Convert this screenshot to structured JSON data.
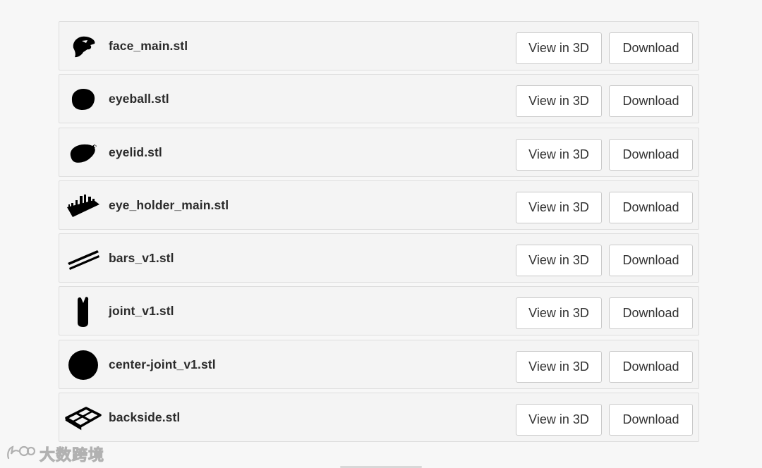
{
  "files": [
    {
      "name": "face_main.stl",
      "icon": "face-main-model-icon",
      "view_label": "View in 3D",
      "download_label": "Download"
    },
    {
      "name": "eyeball.stl",
      "icon": "eyeball-model-icon",
      "view_label": "View in 3D",
      "download_label": "Download"
    },
    {
      "name": "eyelid.stl",
      "icon": "eyelid-model-icon",
      "view_label": "View in 3D",
      "download_label": "Download"
    },
    {
      "name": "eye_holder_main.stl",
      "icon": "eye-holder-model-icon",
      "view_label": "View in 3D",
      "download_label": "Download"
    },
    {
      "name": "bars_v1.stl",
      "icon": "bars-model-icon",
      "view_label": "View in 3D",
      "download_label": "Download"
    },
    {
      "name": "joint_v1.stl",
      "icon": "joint-model-icon",
      "view_label": "View in 3D",
      "download_label": "Download"
    },
    {
      "name": "center-joint_v1.stl",
      "icon": "center-joint-model-icon",
      "view_label": "View in 3D",
      "download_label": "Download"
    },
    {
      "name": "backside.stl",
      "icon": "backside-model-icon",
      "view_label": "View in 3D",
      "download_label": "Download"
    }
  ],
  "watermark": {
    "text": "大数跨境",
    "icon": "watermark-logo-icon"
  },
  "colors": {
    "background": "#f7f7f7",
    "row_background": "#f4f4f4",
    "row_border": "#dedede",
    "button_border": "#c9c9c9",
    "text": "#2b2b2b"
  }
}
